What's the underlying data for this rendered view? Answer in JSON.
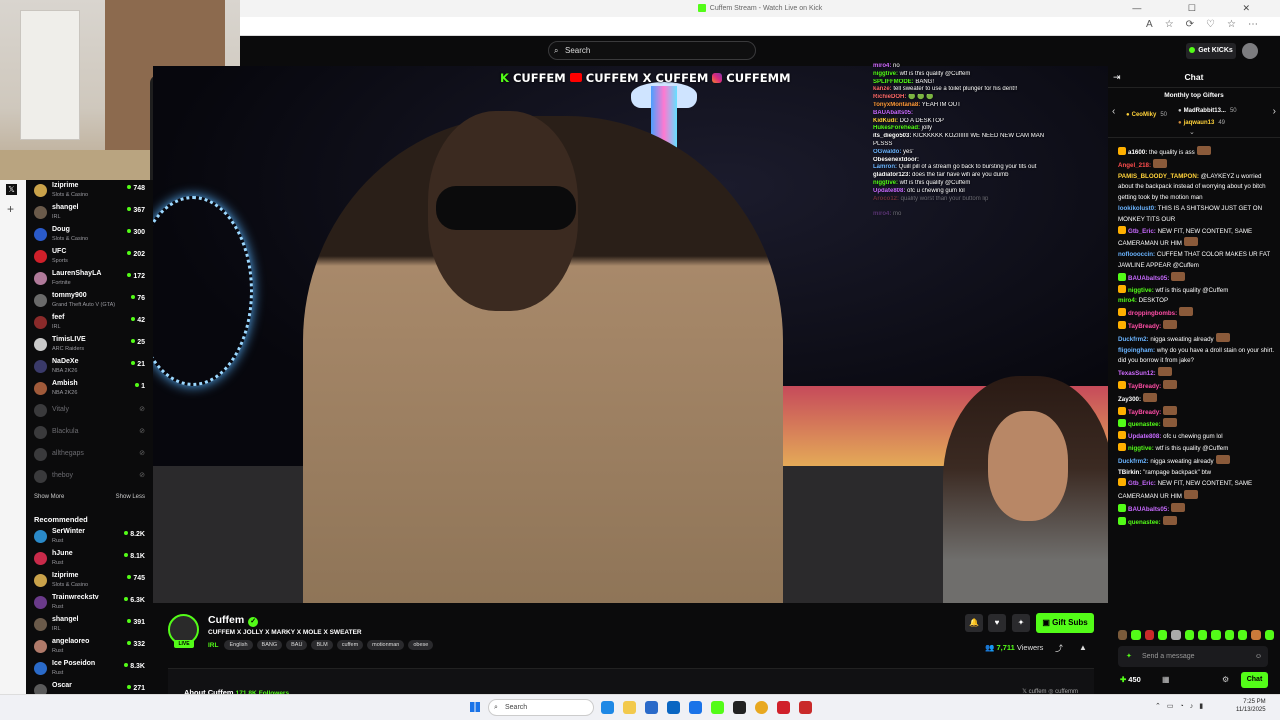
{
  "browser": {
    "tab_title": "Cuffem Stream - Watch Live on Kick",
    "window_controls": "— ☐ ✕"
  },
  "site": {
    "search_placeholder": "Search",
    "get_kicks_label": "Get KICKs"
  },
  "sidebar": {
    "following": [
      {
        "name": "Iziprime",
        "category": "Slots & Casino",
        "viewers": "748",
        "color": "#c9a24a"
      },
      {
        "name": "shangel",
        "category": "IRL",
        "viewers": "367",
        "color": "#6a5a4a"
      },
      {
        "name": "Doug",
        "category": "Slots & Casino",
        "viewers": "300",
        "color": "#2a5ac9"
      },
      {
        "name": "UFC",
        "category": "Sports",
        "viewers": "202",
        "color": "#d0202a"
      },
      {
        "name": "LaurenShayLA",
        "category": "Fortnite",
        "viewers": "172",
        "color": "#b07a9a"
      },
      {
        "name": "tommy900",
        "category": "Grand Theft Auto V (GTA)",
        "viewers": "76",
        "color": "#6a6a6a"
      },
      {
        "name": "feef",
        "category": "IRL",
        "viewers": "42",
        "color": "#8a2a2a"
      },
      {
        "name": "TimisLIVE",
        "category": "ARC Raiders",
        "viewers": "25",
        "color": "#c9c9c9"
      },
      {
        "name": "NaDeXe",
        "category": "NBA 2K26",
        "viewers": "21",
        "color": "#3a3a6a"
      },
      {
        "name": "Ambish",
        "category": "NBA 2K26",
        "viewers": "1",
        "color": "#a05a3a"
      }
    ],
    "offline": [
      "Vitaly",
      "Blackula",
      "allthegaps",
      "theboy"
    ],
    "show_more": "Show More",
    "show_less": "Show Less",
    "recommended_header": "Recommended",
    "recommended": [
      {
        "name": "SerWinter",
        "category": "Rust",
        "viewers": "8.2K",
        "color": "#2a8ac9"
      },
      {
        "name": "hJune",
        "category": "Rust",
        "viewers": "8.1K",
        "color": "#c92a4a"
      },
      {
        "name": "Iziprime",
        "category": "Slots & Casino",
        "viewers": "745",
        "color": "#c9a24a"
      },
      {
        "name": "Trainwreckstv",
        "category": "Rust",
        "viewers": "6.3K",
        "color": "#6a3a8a"
      },
      {
        "name": "shangel",
        "category": "IRL",
        "viewers": "391",
        "color": "#6a5a4a"
      },
      {
        "name": "angelaoreo",
        "category": "Rust",
        "viewers": "332",
        "color": "#b07a6a"
      },
      {
        "name": "Ice Poseidon",
        "category": "Rust",
        "viewers": "8.3K",
        "color": "#2a6ac9"
      },
      {
        "name": "Oscar",
        "category": "",
        "viewers": "271",
        "color": "#5a5a5a"
      }
    ]
  },
  "video": {
    "overlay_k": "K",
    "overlay_text1": "CUFFEM",
    "overlay_text2": "CUFFEM",
    "overlay_x": "X",
    "overlay_text3": "CUFFEM",
    "overlay_text4": "CUFFEMM",
    "overlay_chat": [
      {
        "user": "miro4:",
        "text": " no",
        "color": "#d06aff"
      },
      {
        "user": "niggtive:",
        "text": " wtf is this quality @Cuffem",
        "color": "#53fc18"
      },
      {
        "user": "SPLIFFMODE:",
        "text": " BANG!",
        "color": "#53fc18"
      },
      {
        "user": "kanze:",
        "text": " tell sweater to use a toilet plunger for his dent!!",
        "color": "#ff6a6a"
      },
      {
        "user": "RichieDOH:",
        "text": " 🟢 🟢 🟢",
        "color": "#ff6a6a"
      },
      {
        "user": "TonyxMontana8:",
        "text": " YEAH IM OUT",
        "color": "#ff9a3a"
      },
      {
        "user": "BAUAbalts05:",
        "text": "",
        "color": "#c86aff"
      },
      {
        "user": "KidKudi:",
        "text": " DO A DESKTOP",
        "color": "#ffd23a"
      },
      {
        "user": "HukesForehead:",
        "text": " jolly",
        "color": "#53fc18"
      },
      {
        "user": "its_diego503:",
        "text": " KICKKKKK KOZIIIIIII WE NEED NEW CAM MAN",
        "color": "#ffffff"
      },
      {
        "user": "",
        "text": "PLSSS",
        "color": "#ffffff"
      },
      {
        "user": "OGwaldo:",
        "text": " yes'",
        "color": "#6ab4ff"
      },
      {
        "user": "Obesenextdoor:",
        "text": "",
        "color": "#ffffff"
      },
      {
        "user": "Lamron:",
        "text": " Quill pill of a stream go back to bursting your tits out",
        "color": "#6ab4ff"
      },
      {
        "user": "gladiator123:",
        "text": " does the fair have wifi are you dumb",
        "color": "#ffffff"
      },
      {
        "user": "niggtive:",
        "text": " wtf is this quality @Cuffem",
        "color": "#53fc18"
      },
      {
        "user": "Update808:",
        "text": " ofc u chewing gum lol",
        "color": "#c86aff"
      },
      {
        "user": "Aroco12:",
        "text": " quality worst than your buttom lip",
        "color": "#ff5a5a"
      },
      {
        "user": "",
        "text": "",
        "color": "#ffffff"
      },
      {
        "user": "miro4:",
        "text": " mo",
        "color": "#d06aff"
      }
    ]
  },
  "channel": {
    "live_label": "LIVE",
    "name": "Cuffem",
    "verified_mark": "✓",
    "title": "CUFFEM X JOLLY X MARKY X MOLE X SWEATER",
    "category": "IRL",
    "tags": [
      "English",
      "BANG",
      "BAU",
      "BLM",
      "cuffem",
      "motionman",
      "obese"
    ],
    "gift_subs_label": "Gift Subs",
    "viewers_count": "7,711",
    "viewers_label": "Viewers",
    "about_label": "About Cuffem",
    "followers_count": "171.8K",
    "followers_label": "Followers",
    "socials": "𝕏 cuffem   ◎ cuffemm"
  },
  "chat": {
    "title": "Chat",
    "gifters_title": "Monthly top Gifters",
    "gifters": [
      {
        "name": "CeoMiky",
        "amount": "50",
        "color": "#ffd23a"
      },
      {
        "name": "MadRabbit13...",
        "amount": "50",
        "color": "#ffffff"
      },
      {
        "name": "jaqwaun13",
        "amount": "49",
        "color": "#ffd23a"
      }
    ],
    "messages": [
      {
        "user": "a1600:",
        "text": " the quality is ass",
        "color": "#ffffff",
        "badge": "#ffb000",
        "emote": true
      },
      {
        "user": "Angel_218:",
        "text": "",
        "color": "#ff4d4d",
        "badge": "",
        "emote": true
      },
      {
        "user": "PAMIS_BLOODY_TAMPON:",
        "text": " @LAYKEYZ u worried about the backpack instead of worrying about yo bitch getting took by the motion man",
        "color": "#ffd23a",
        "badge": "",
        "emote": false
      },
      {
        "user": "lookikolust0:",
        "text": " THIS IS A SHITSHOW JUST GET ON MONKEY TITS OUR",
        "color": "#6ab4ff",
        "badge": "",
        "emote": false
      },
      {
        "user": "Gtb_Eric:",
        "text": " NEW FIT, NEW CONTENT, SAME CAMERAMAN UR HIM",
        "color": "#c86aff",
        "badge": "#ffb000",
        "emote": true
      },
      {
        "user": "nofloooccin:",
        "text": " CUFFEM THAT COLOR MAKES UR FAT JAWLINE APPEAR @Cuffem",
        "color": "#6ab4ff",
        "badge": "",
        "emote": false
      },
      {
        "user": "BAUAbalts05:",
        "text": "",
        "color": "#c86aff",
        "badge": "#53fc18",
        "emote": true
      },
      {
        "user": "niggtive:",
        "text": " wtf is this quality @Cuffem",
        "color": "#53fc18",
        "badge": "#ffb000",
        "emote": false
      },
      {
        "user": "miro4:",
        "text": " DESKTOP",
        "color": "#53fc18",
        "badge": "",
        "emote": false
      },
      {
        "user": "droppingbombs:",
        "text": "",
        "color": "#ff4da6",
        "badge": "#ffb000",
        "emote": true
      },
      {
        "user": "TayBready:",
        "text": "",
        "color": "#ff4da6",
        "badge": "#ffb000",
        "emote": true
      },
      {
        "user": "Duckfrm2:",
        "text": " nigga sweating already",
        "color": "#6ab4ff",
        "badge": "",
        "emote": true
      },
      {
        "user": "fligoingham:",
        "text": " why do you have a droll stain on your shirt. did you borrow it from jake?",
        "color": "#6ab4ff",
        "badge": "",
        "emote": false
      },
      {
        "user": "TexasSun12:",
        "text": "",
        "color": "#d06aff",
        "badge": "",
        "emote": true
      },
      {
        "user": "TayBready:",
        "text": "",
        "color": "#ff4da6",
        "badge": "#ffb000",
        "emote": true
      },
      {
        "user": "Zay300:",
        "text": "",
        "color": "#ffffff",
        "badge": "",
        "emote": true
      },
      {
        "user": "TayBready:",
        "text": "",
        "color": "#ff4da6",
        "badge": "#ffb000",
        "emote": true
      },
      {
        "user": "quenastee:",
        "text": "",
        "color": "#53fc18",
        "badge": "#53fc18",
        "emote": true
      },
      {
        "user": "Update808:",
        "text": " ofc u chewing gum lol",
        "color": "#c86aff",
        "badge": "#ffb000",
        "emote": false
      },
      {
        "user": "niggtive:",
        "text": " wtf is this quality @Cuffem",
        "color": "#53fc18",
        "badge": "#ffb000",
        "emote": false
      },
      {
        "user": "Duckfrm2:",
        "text": " nigga sweating already",
        "color": "#6ab4ff",
        "badge": "",
        "emote": true
      },
      {
        "user": "TBirkin:",
        "text": " \"rampage backpack\" btw",
        "color": "#ffffff",
        "badge": "",
        "emote": false
      },
      {
        "user": "Gtb_Eric:",
        "text": " NEW FIT, NEW CONTENT, SAME CAMERAMAN UR HIM",
        "color": "#c86aff",
        "badge": "#ffb000",
        "emote": true
      },
      {
        "user": "BAUAbalts05:",
        "text": "",
        "color": "#c86aff",
        "badge": "#53fc18",
        "emote": true
      },
      {
        "user": "quenastee:",
        "text": "",
        "color": "#53fc18",
        "badge": "#53fc18",
        "emote": true
      }
    ],
    "input_placeholder": "Send a message",
    "points": "450",
    "chat_button": "Chat"
  },
  "taskbar": {
    "search_label": "Search",
    "time": "7:25 PM",
    "date": "11/13/2025"
  }
}
